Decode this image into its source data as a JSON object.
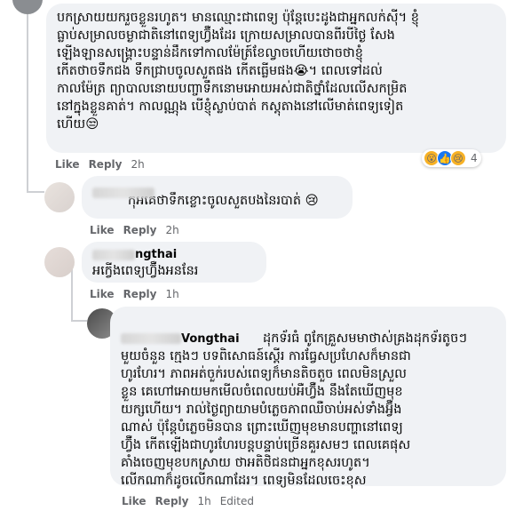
{
  "comments": [
    {
      "id": "c1",
      "text": "បកស្រាយយករួចខ្លួនរហូត។ មានឈ្មោះជាពេទ្យ ប៉ុន្តែបេះដូងជាអ្នកលក់ស៊ី។ ខ្ញុំ\nធ្លាប់សម្រាលចម្ងាជាតិនៅពេទ្យហ្វ៊ឺងដែរ ក្រោយសម្រាលបានពីរបីថ្ងៃ សែង\nឡើងឡានសង្គ្រោះបន្ទាន់ដឹកទៅកាលម៉ែត្រ៍ខែល្វាចហើយថោចថាខ្ញុំ\nកើតថាចទឹកជង ទឹកជ្រាបចូលសួតផង កើតធ្លើមផង😭។ ពេលទៅដល់\nកាលម៉ែត្រ ព្យាបាលនោយបញ្ចាទឹកនោមអោយអស់ជាតិថ្នាំដែលលើសកម្រិត\nនៅក្នុងខ្លួនគាត់។ កាលណ្ណុង បើខ្ញុំស្លាប់បាត់ កស្តុតាងនៅលើមាត់ពេទ្យទៀត\nហើយ😒",
      "actions": {
        "like": "Like",
        "reply": "Reply",
        "time": "2h"
      },
      "reactions": {
        "count": "4"
      }
    },
    {
      "id": "c2",
      "text": "កុំអីគេថាទឹកខ្លោះចូលសួតបងនៃរបាត់ 😢",
      "actions": {
        "like": "Like",
        "reply": "Reply",
        "time": "2h"
      }
    },
    {
      "id": "c3",
      "name_partial": "ngthai",
      "text": "អកើ្វងពេទ្យហ្វ៊ឺងអននែរ",
      "actions": {
        "like": "Like",
        "reply": "Reply",
        "time": "1h"
      }
    },
    {
      "id": "c4",
      "name_partial": "Vongthai",
      "text": "ដុកទ័រធំ ពូកែគ្រួសមមាថាស់គ្រងដុកទ័រតូចៗ\nមួយចំនួន ក្មេងៗ បទពិសោធន៍ស្តើរ ការធ្វែសប្រហែសក៏មានជា\nហូរហែរ។ ភាពអត់ចួក់របស់ពេទ្យក៏មានតិចតួច ពេលមិនស្រួល\nខ្លួន គេហៅអោយមកមើលចំពេលយប់អឺហ្វ៊ឺង នឹងតែឃើញមុខ\nយក្សហើយ។ រាល់ថ្ងៃព្យាយាមបំភ្លេចភាពឈឺចាប់អស់ទាំងអ្វ៊ឺង\nណាស់ ប៉ុន្តែបំភ្លេចមិនបាន ព្រោះឃើញមុខមានបញ្ហានៅពេទ្យ\nហ្វ៊ឺង កើតឡើងជាហូរហែរបន្តបន្ទាប់ច្រើនគួរសមៗ ពេលគេផុស\nគាំងចេញមុខបកស្រាយ ថាអតិថិជនជាអ្នកខុសរហូត។\nលើកណាក៏ដូចលើកណាដែរ។ ពេទ្យមិនដែលចេះខុស",
      "actions": {
        "like": "Like",
        "reply": "Reply",
        "time": "1h",
        "edited": "Edited"
      }
    }
  ],
  "colors": {
    "bubble_bg": "#f0f2f5",
    "meta_text": "#65676b",
    "thread_line": "#ced0d4"
  },
  "icons": [
    "wow-reaction-icon",
    "like-reaction-icon",
    "sad-reaction-icon",
    "sad-emoji-icon"
  ]
}
